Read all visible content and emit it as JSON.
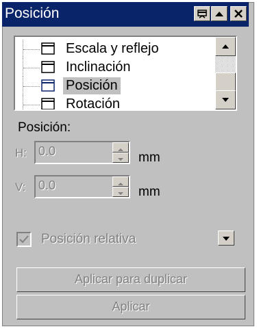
{
  "titlebar": {
    "title": "Posición"
  },
  "tree": {
    "items": [
      {
        "label": "Escala y reflejo"
      },
      {
        "label": "Inclinación"
      },
      {
        "label": "Posición"
      },
      {
        "label": "Rotación"
      }
    ],
    "selected_label": "Posición"
  },
  "section": {
    "label": "Posición:"
  },
  "h": {
    "label": "H:",
    "value": "0.0",
    "unit": "mm"
  },
  "v": {
    "label": "V:",
    "value": "0.0",
    "unit": "mm"
  },
  "relative": {
    "label": "Posición relativa",
    "checked": true,
    "enabled": false
  },
  "buttons": {
    "apply_duplicate": "Aplicar para duplicar",
    "apply": "Aplicar"
  },
  "colors": {
    "titlebar": "#0a246a",
    "face": "#c0c0c0",
    "disabled_text": "#808080"
  }
}
